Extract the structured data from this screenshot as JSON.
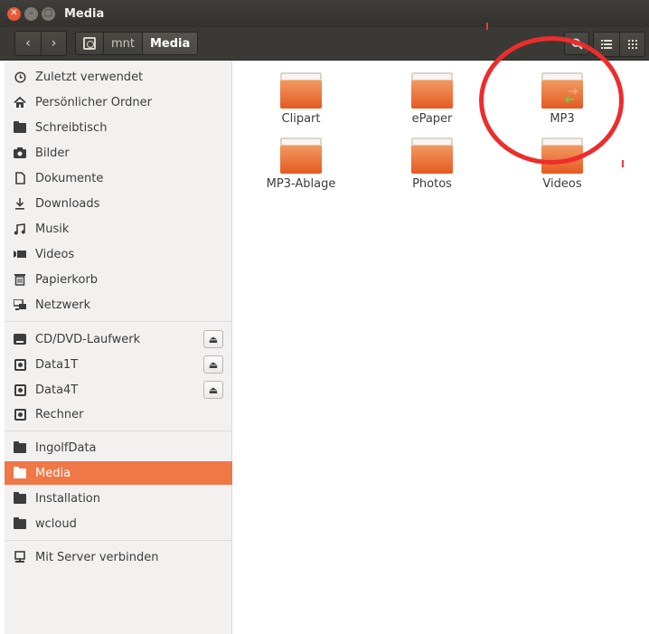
{
  "window": {
    "title": "Media"
  },
  "toolbar": {
    "breadcrumbs": [
      "mnt",
      "Media"
    ],
    "icons": {
      "back": "chevron-left-icon",
      "forward": "chevron-right-icon",
      "search": "search-icon",
      "list_view": "list-view-icon",
      "grid_view": "grid-view-icon"
    }
  },
  "sidebar": {
    "places": [
      {
        "label": "Zuletzt verwendet",
        "icon": "clock-icon"
      },
      {
        "label": "Persönlicher Ordner",
        "icon": "home-icon"
      },
      {
        "label": "Schreibtisch",
        "icon": "folder-icon"
      },
      {
        "label": "Bilder",
        "icon": "camera-icon"
      },
      {
        "label": "Dokumente",
        "icon": "document-icon"
      },
      {
        "label": "Downloads",
        "icon": "download-icon"
      },
      {
        "label": "Musik",
        "icon": "music-icon"
      },
      {
        "label": "Videos",
        "icon": "video-icon"
      },
      {
        "label": "Papierkorb",
        "icon": "trash-icon"
      },
      {
        "label": "Netzwerk",
        "icon": "network-icon"
      }
    ],
    "devices": [
      {
        "label": "CD/DVD-Laufwerk",
        "icon": "optical-drive-icon",
        "eject": true
      },
      {
        "label": "Data1T",
        "icon": "drive-icon",
        "eject": true
      },
      {
        "label": "Data4T",
        "icon": "drive-icon",
        "eject": true
      },
      {
        "label": "Rechner",
        "icon": "drive-icon",
        "eject": false
      }
    ],
    "bookmarks": [
      {
        "label": "IngolfData",
        "icon": "folder-icon",
        "selected": false
      },
      {
        "label": "Media",
        "icon": "folder-icon",
        "selected": true
      },
      {
        "label": "Installation",
        "icon": "folder-icon",
        "selected": false
      },
      {
        "label": "wcloud",
        "icon": "folder-icon",
        "selected": false
      }
    ],
    "connect": {
      "label": "Mit Server verbinden",
      "icon": "server-icon"
    }
  },
  "files": [
    {
      "name": "Clipart",
      "type": "folder",
      "symlink": false
    },
    {
      "name": "ePaper",
      "type": "folder",
      "symlink": false
    },
    {
      "name": "MP3",
      "type": "folder",
      "symlink": true
    },
    {
      "name": "MP3-Ablage",
      "type": "folder",
      "symlink": false
    },
    {
      "name": "Photos",
      "type": "folder",
      "symlink": false
    },
    {
      "name": "Videos",
      "type": "folder",
      "symlink": false
    }
  ],
  "colors": {
    "accent": "#f07746",
    "folder_orange": "#e55a21",
    "annotation_red": "#ee2c2c"
  }
}
